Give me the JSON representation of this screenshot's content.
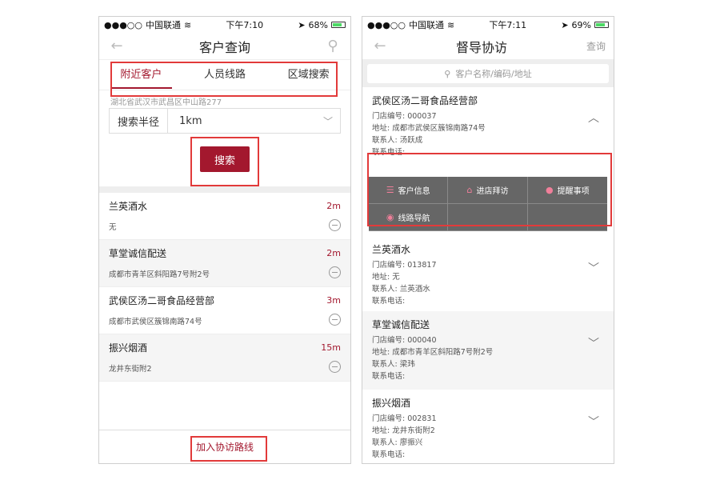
{
  "left": {
    "status": {
      "signal": "●●●○○",
      "carrier": "中国联通",
      "time": "下午7:10",
      "battery": "68%"
    },
    "nav": {
      "title": "客户查询"
    },
    "tabs": [
      {
        "label": "附近客户",
        "active": true
      },
      {
        "label": "人员线路",
        "active": false
      },
      {
        "label": "区域搜索",
        "active": false
      }
    ],
    "address": "湖北省武汉市武昌区中山路277",
    "radius": {
      "label": "搜索半径",
      "value": "1km"
    },
    "search_button": "搜索",
    "customers": [
      {
        "name": "兰英酒水",
        "distance": "2m",
        "sub": "无"
      },
      {
        "name": "草堂诚信配送",
        "distance": "2m",
        "sub": "成都市青羊区斜阳路7号附2号"
      },
      {
        "name": "武侯区汤二哥食品经营部",
        "distance": "3m",
        "sub": "成都市武侯区簇锦南路74号"
      },
      {
        "name": "振兴烟酒",
        "distance": "15m",
        "sub": "龙井东街附2"
      }
    ],
    "bottom_button": "加入协访路线"
  },
  "right": {
    "status": {
      "signal": "●●●○○",
      "carrier": "中国联通",
      "time": "下午7:11",
      "battery": "69%"
    },
    "nav": {
      "title": "督导协访",
      "action": "查询"
    },
    "search_placeholder": "客户名称/编码/地址",
    "expanded": {
      "name": "武侯区汤二哥食品经营部",
      "code": "门店编号: 000037",
      "address": "地址: 成都市武侯区簇锦南路74号",
      "contact": "联系人: 汤跃成",
      "phone": "联系电话:"
    },
    "actions": [
      {
        "label": "客户信息",
        "icon": "list-icon"
      },
      {
        "label": "进店拜访",
        "icon": "store-icon"
      },
      {
        "label": "提醒事项",
        "icon": "bulb-icon"
      },
      {
        "label": "线路导航",
        "icon": "compass-icon"
      }
    ],
    "list": [
      {
        "name": "兰英酒水",
        "code": "门店编号: 013817",
        "address": "地址: 无",
        "contact": "联系人: 兰英酒水",
        "phone": "联系电话:"
      },
      {
        "name": "草堂诚信配送",
        "code": "门店编号: 000040",
        "address": "地址: 成都市青羊区斜阳路7号附2号",
        "contact": "联系人: 梁玮",
        "phone": "联系电话:"
      },
      {
        "name": "振兴烟酒",
        "code": "门店编号: 002831",
        "address": "地址: 龙井东街附2",
        "contact": "联系人: 廖振兴",
        "phone": "联系电话:"
      }
    ]
  },
  "colors": {
    "accent": "#a3182e",
    "highlight": "#e23a3a",
    "action_bg": "#666666"
  }
}
